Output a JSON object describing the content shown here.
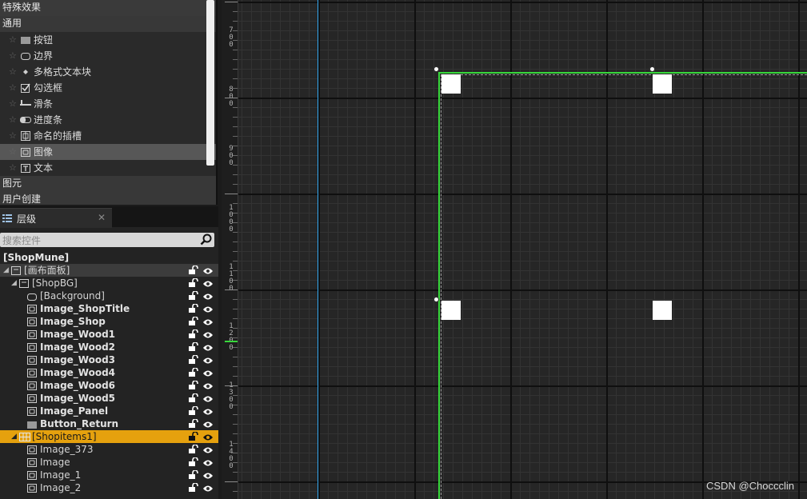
{
  "palette": {
    "categories": [
      "特殊效果",
      "通用",
      "图元",
      "用户创建"
    ],
    "items": [
      {
        "label": "按钮",
        "icon": "button-icon"
      },
      {
        "label": "边界",
        "icon": "border-icon"
      },
      {
        "label": "多格式文本块",
        "icon": "rich-text-icon"
      },
      {
        "label": "勾选框",
        "icon": "checkbox-icon"
      },
      {
        "label": "滑条",
        "icon": "slider-icon"
      },
      {
        "label": "进度条",
        "icon": "progress-bar-icon"
      },
      {
        "label": "命名的插槽",
        "icon": "named-slot-icon"
      },
      {
        "label": "图像",
        "icon": "image-icon",
        "selected": true
      },
      {
        "label": "文本",
        "icon": "text-icon"
      }
    ]
  },
  "hierarchy": {
    "tab_label": "层级",
    "tab_close": "✕",
    "search_placeholder": "搜索控件",
    "root": "[ShopMune]",
    "rows": [
      {
        "label": "[画布面板]",
        "indent": 0,
        "arrow": "◢",
        "icon": "panel-icon",
        "bold": false,
        "hl": true
      },
      {
        "label": "[ShopBG]",
        "indent": 1,
        "arrow": "◢",
        "icon": "panel-icon",
        "bold": false
      },
      {
        "label": "[Background]",
        "indent": 2,
        "icon": "border-icon",
        "bold": false
      },
      {
        "label": "Image_ShopTitle",
        "indent": 2,
        "icon": "image-icon",
        "bold": true
      },
      {
        "label": "Image_Shop",
        "indent": 2,
        "icon": "image-icon",
        "bold": true
      },
      {
        "label": "Image_Wood1",
        "indent": 2,
        "icon": "image-icon",
        "bold": true
      },
      {
        "label": "Image_Wood2",
        "indent": 2,
        "icon": "image-icon",
        "bold": true
      },
      {
        "label": "Image_Wood3",
        "indent": 2,
        "icon": "image-icon",
        "bold": true
      },
      {
        "label": "Image_Wood4",
        "indent": 2,
        "icon": "image-icon",
        "bold": true
      },
      {
        "label": "Image_Wood6",
        "indent": 2,
        "icon": "image-icon",
        "bold": true
      },
      {
        "label": "Image_Wood5",
        "indent": 2,
        "icon": "image-icon",
        "bold": true
      },
      {
        "label": "Image_Panel",
        "indent": 2,
        "icon": "image-icon",
        "bold": true
      },
      {
        "label": "Button_Return",
        "indent": 2,
        "icon": "button-icon",
        "bold": true
      },
      {
        "label": "[Shopitems1]",
        "indent": 1,
        "arrow": "◢",
        "icon": "grid-panel-icon",
        "bold": false,
        "selected": true
      },
      {
        "label": "Image_373",
        "indent": 2,
        "icon": "image-icon",
        "bold": false
      },
      {
        "label": "Image",
        "indent": 2,
        "icon": "image-icon",
        "bold": false
      },
      {
        "label": "Image_1",
        "indent": 2,
        "icon": "image-icon",
        "bold": false
      },
      {
        "label": "Image_2",
        "indent": 2,
        "icon": "image-icon",
        "bold": false
      }
    ]
  },
  "ruler": {
    "labels": [
      {
        "digits": [
          "7",
          "0",
          "0"
        ]
      },
      {
        "digits": [
          "8",
          "0",
          "0"
        ]
      },
      {
        "digits": [
          "9",
          "0",
          "0"
        ]
      },
      {
        "digits": [
          "1",
          "0",
          "0",
          "0"
        ]
      },
      {
        "digits": [
          "1",
          "1",
          "0",
          "0"
        ]
      },
      {
        "digits": [
          "1",
          "2",
          "0",
          "0"
        ]
      },
      {
        "digits": [
          "1",
          "3",
          "0",
          "0"
        ]
      },
      {
        "digits": [
          "1",
          "4",
          "0",
          "0"
        ]
      }
    ]
  },
  "watermark": "CSDN @Choccclin",
  "colors": {
    "selection": "#e5a10e",
    "widget_outline": "#37d73b",
    "guide_line": "#35a8f0"
  }
}
